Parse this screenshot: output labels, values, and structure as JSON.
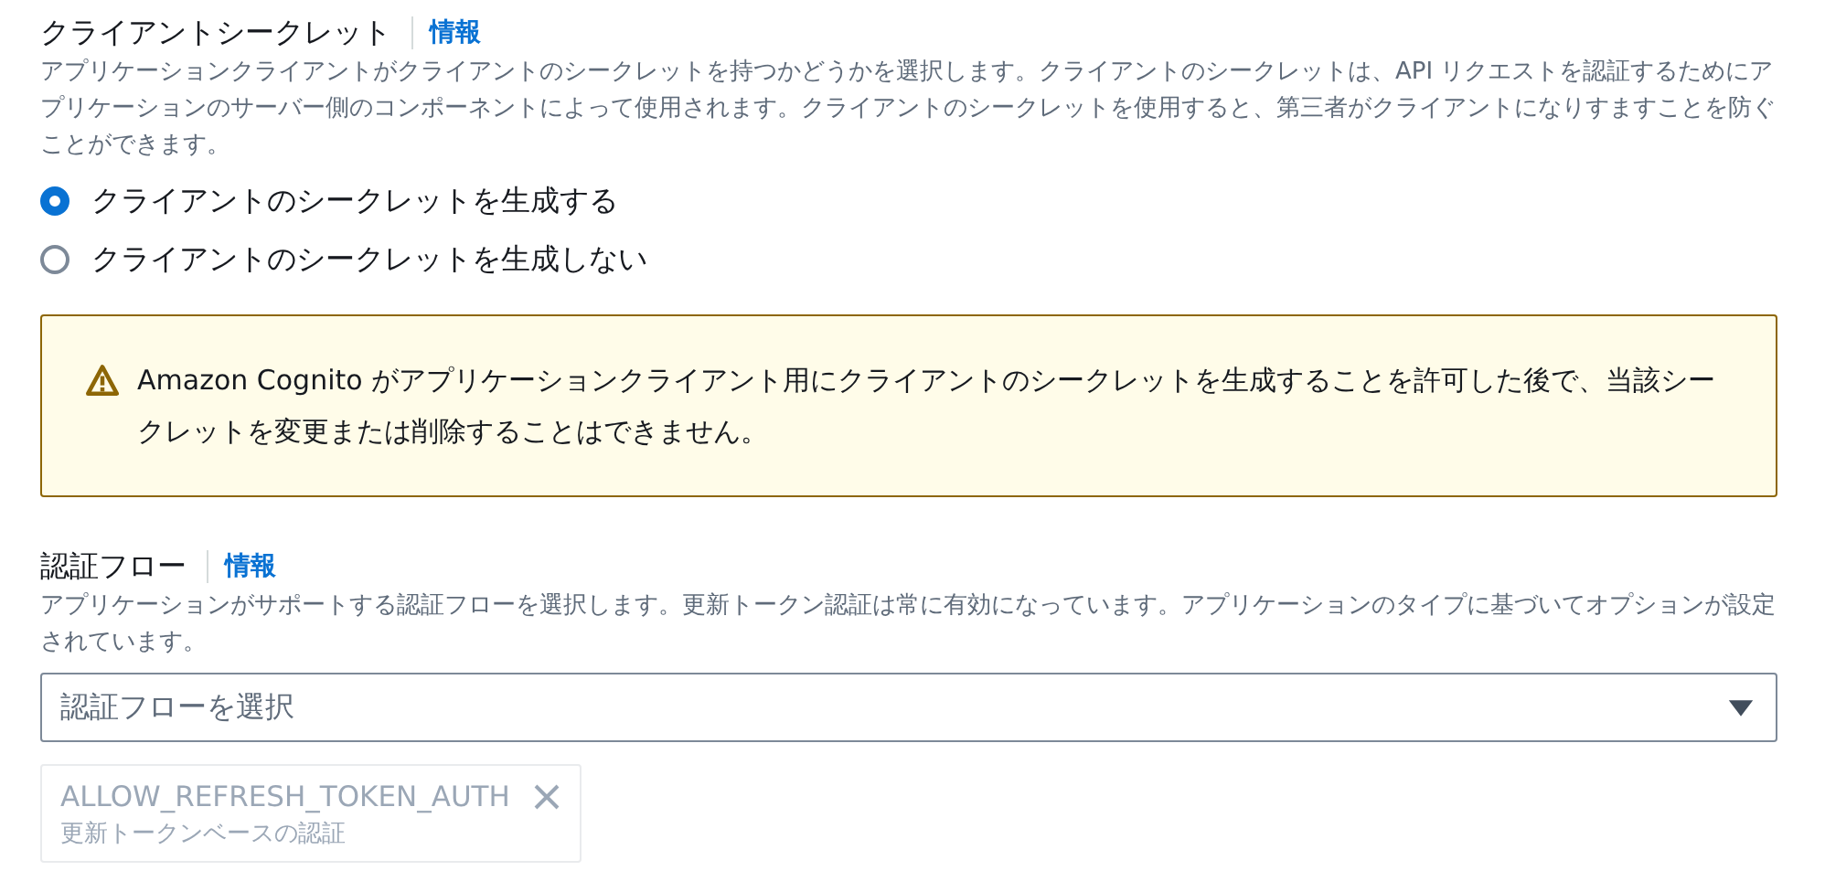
{
  "client_secret": {
    "label": "クライアントシークレット",
    "info_link": "情報",
    "description": "アプリケーションクライアントがクライアントのシークレットを持つかどうかを選択します。クライアントのシークレットは、API リクエストを認証するためにアプリケーションのサーバー側のコンポーネントによって使用されます。クライアントのシークレットを使用すると、第三者がクライアントになりすますことを防ぐことができます。",
    "options": [
      {
        "label": "クライアントのシークレットを生成する",
        "selected": true
      },
      {
        "label": "クライアントのシークレットを生成しない",
        "selected": false
      }
    ],
    "alert": {
      "text": "Amazon Cognito がアプリケーションクライアント用にクライアントのシークレットを生成することを許可した後で、当該シークレットを変更または削除することはできません。"
    }
  },
  "auth_flows": {
    "label": "認証フロー",
    "info_link": "情報",
    "description": "アプリケーションがサポートする認証フローを選択します。更新トークン認証は常に有効になっています。アプリケーションのタイプに基づいてオプションが設定されています。",
    "select": {
      "placeholder": "認証フローを選択"
    },
    "tokens": [
      {
        "label": "ALLOW_REFRESH_TOKEN_AUTH",
        "description": "更新トークンベースの認証",
        "disabled": true
      }
    ]
  }
}
